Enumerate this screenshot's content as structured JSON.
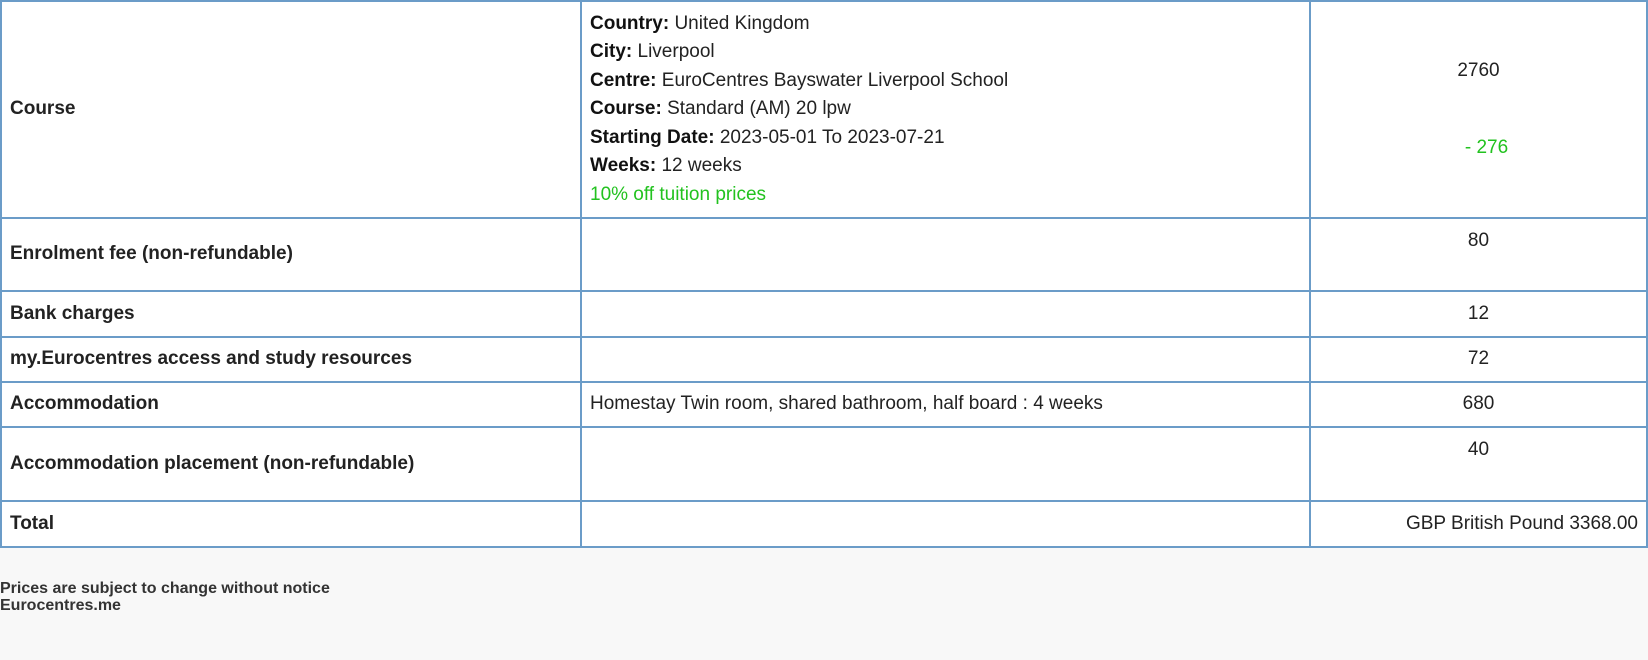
{
  "rows": {
    "course": {
      "label": "Course",
      "details": [
        {
          "key": "Country:",
          "value": "United Kingdom"
        },
        {
          "key": "City:",
          "value": "Liverpool"
        },
        {
          "key": "Centre:",
          "value": "EuroCentres Bayswater Liverpool School"
        },
        {
          "key": "Course:",
          "value": "Standard (AM) 20 lpw"
        },
        {
          "key": "Starting Date:",
          "value": "2023-05-01 To 2023-07-21"
        },
        {
          "key": "Weeks:",
          "value": "12 weeks"
        }
      ],
      "promo": "10% off tuition prices",
      "amount": "2760",
      "discount": "- 276"
    },
    "enrolment": {
      "label": "Enrolment fee (non-refundable)",
      "details": "",
      "amount": "80"
    },
    "bank": {
      "label": "Bank charges",
      "details": "",
      "amount": "12"
    },
    "access": {
      "label": "my.Eurocentres access and study resources",
      "details": "",
      "amount": "72"
    },
    "accommodation": {
      "label": "Accommodation",
      "details": "Homestay Twin room, shared bathroom, half board : 4 weeks",
      "amount": "680"
    },
    "placement": {
      "label": "Accommodation placement (non-refundable)",
      "details": "",
      "amount": "40"
    },
    "total": {
      "label": "Total",
      "details": "",
      "amount": "GBP British Pound 3368.00"
    }
  },
  "footer": {
    "line1": "Prices are subject to change without notice",
    "line2": "Eurocentres.me"
  },
  "colors": {
    "label": "#1c5fa0",
    "border": "#6b9cc8",
    "promo": "#22c21f"
  }
}
